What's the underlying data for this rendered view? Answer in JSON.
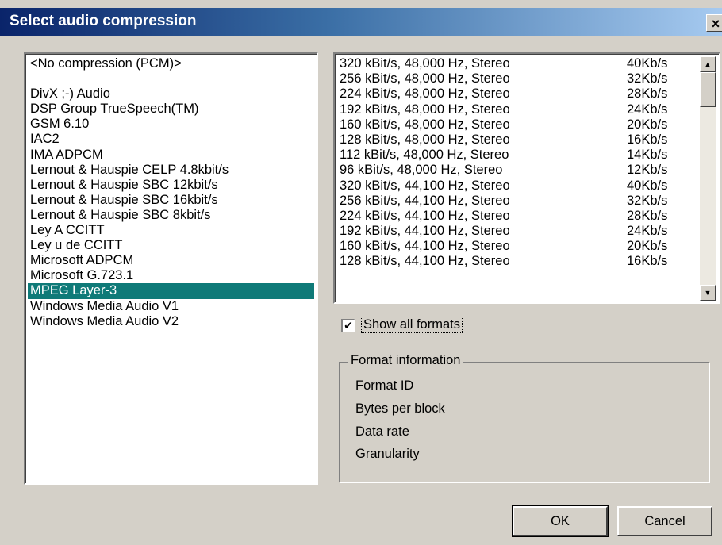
{
  "window": {
    "title": "Select audio compression",
    "close_label": "×"
  },
  "codecs": {
    "items": [
      "<No compression (PCM)>",
      "",
      "DivX ;-) Audio",
      "DSP Group TrueSpeech(TM)",
      "GSM 6.10",
      "IAC2",
      "IMA ADPCM",
      "Lernout & Hauspie CELP 4.8kbit/s",
      "Lernout & Hauspie SBC 12kbit/s",
      "Lernout & Hauspie SBC 16kbit/s",
      "Lernout & Hauspie SBC 8kbit/s",
      "Ley A CCITT",
      "Ley u de CCITT",
      "Microsoft ADPCM",
      "Microsoft G.723.1",
      "MPEG Layer-3",
      "Windows Media Audio V1",
      "Windows Media Audio V2"
    ],
    "selected": "MPEG Layer-3"
  },
  "formats": {
    "rows": [
      {
        "name": "320 kBit/s, 48,000 Hz, Stereo",
        "rate": "40Kb/s"
      },
      {
        "name": "256 kBit/s, 48,000 Hz, Stereo",
        "rate": "32Kb/s"
      },
      {
        "name": "224 kBit/s, 48,000 Hz, Stereo",
        "rate": "28Kb/s"
      },
      {
        "name": "192 kBit/s, 48,000 Hz, Stereo",
        "rate": "24Kb/s"
      },
      {
        "name": "160 kBit/s, 48,000 Hz, Stereo",
        "rate": "20Kb/s"
      },
      {
        "name": "128 kBit/s, 48,000 Hz, Stereo",
        "rate": "16Kb/s"
      },
      {
        "name": "112 kBit/s, 48,000 Hz, Stereo",
        "rate": "14Kb/s"
      },
      {
        "name": "96 kBit/s, 48,000 Hz, Stereo",
        "rate": "12Kb/s"
      },
      {
        "name": "320 kBit/s, 44,100 Hz, Stereo",
        "rate": "40Kb/s"
      },
      {
        "name": "256 kBit/s, 44,100 Hz, Stereo",
        "rate": "32Kb/s"
      },
      {
        "name": "224 kBit/s, 44,100 Hz, Stereo",
        "rate": "28Kb/s"
      },
      {
        "name": "192 kBit/s, 44,100 Hz, Stereo",
        "rate": "24Kb/s"
      },
      {
        "name": "160 kBit/s, 44,100 Hz, Stereo",
        "rate": "20Kb/s"
      },
      {
        "name": "128 kBit/s, 44,100 Hz, Stereo",
        "rate": "16Kb/s"
      }
    ],
    "scroll_up_icon": "▲",
    "scroll_down_icon": "▼"
  },
  "options": {
    "show_all_label": "Show all formats",
    "show_all_checked": "✔"
  },
  "format_info": {
    "legend": "Format information",
    "items": [
      "Format ID",
      "Bytes per block",
      "Data rate",
      "Granularity"
    ]
  },
  "buttons": {
    "ok": "OK",
    "cancel": "Cancel"
  },
  "colors": {
    "selection": "#0f7a78",
    "title_start": "#0a246a",
    "title_end": "#a6caf0",
    "face": "#d4d0c8"
  }
}
